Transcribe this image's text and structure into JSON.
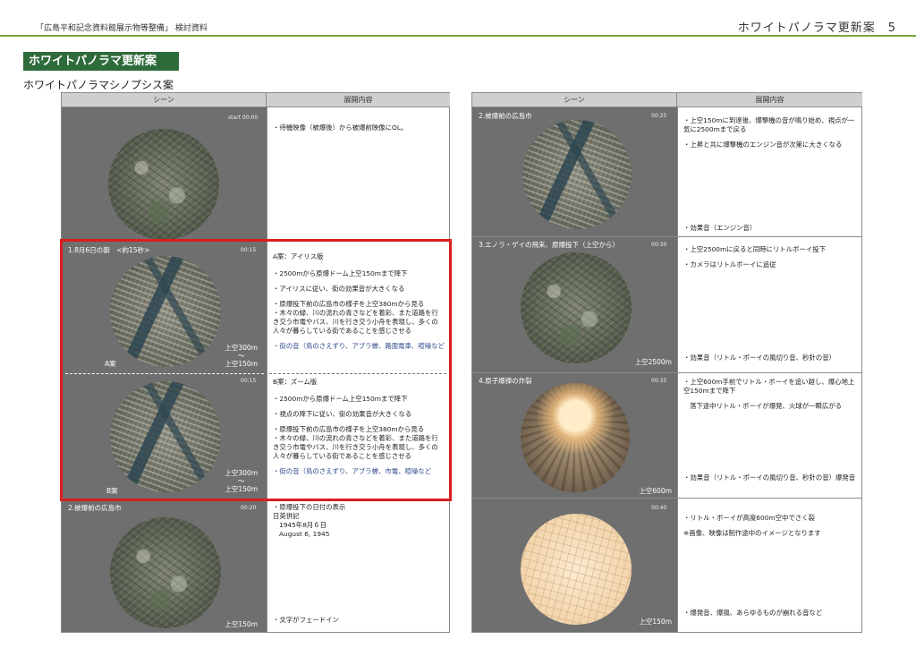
{
  "header": {
    "left": "「広島平和記念資料館展示物等整備」 検討資料",
    "right": "ホワイトパノラマ更新案　5"
  },
  "title": "ホワイトパノラマ更新案",
  "subtitle": "ホワイトパノラマシノプシス案",
  "columns": {
    "scene": "シーン",
    "content": "展開内容"
  },
  "left": {
    "row1": {
      "time": "start 00:00",
      "items": [
        "・待機映像（被爆後）から被爆前映像にOL。"
      ]
    },
    "row2": {
      "title": "1.8月6日の朝　<約15秒>",
      "a": {
        "time": "00:15",
        "label": "A案",
        "alt1": "上空300m",
        "tilde": "〜",
        "alt2": "上空150m",
        "heading": "A案：アイリス版",
        "items": [
          "・2500mから原爆ドーム上空150mまで降下",
          "・アイリスに従い、街の効果音が大きくなる",
          "・原爆投下前の広島市の様子を上空380mから見る",
          "・木々の緑、川の流れの青さなどを着彩、また道路を行き交う市電やバス、川を行き交う小舟を表現し、多くの人々が暮らしている街であることを感じさせる"
        ],
        "sound": "・街の音（鳥のさえずり、アブラ蝉、路面電車、喧噪など"
      },
      "b": {
        "time": "00:15",
        "label": "B案",
        "alt1": "上空300m",
        "tilde": "〜",
        "alt2": "上空150m",
        "heading": "B案：ズーム版",
        "items": [
          "・2500mから原爆ドーム上空150mまで降下",
          "・視点の降下に従い、街の効果音が大きくなる",
          "・原爆投下前の広島市の様子を上空380mから見る",
          "・木々の緑、川の流れの青さなどを着彩、また道路を行き交う市電やバス、川を行き交う小舟を表現し、多くの人々が暮らしている街であることを感じさせる"
        ],
        "sound": "・街の音（鳥のさえずり、アブラ蝉、市電、喧噪など"
      }
    },
    "row3": {
      "title": "2.被爆前の広島市",
      "time": "00:20",
      "alt": "上空150m",
      "lines": [
        "・原爆投下の日付の表示",
        "日英併記",
        "1945年8月６日",
        "August 6, 1945"
      ],
      "bottom": "・文字がフェードイン"
    }
  },
  "right": {
    "row1": {
      "title": "2.被爆前の広島市",
      "time": "00:25",
      "items": [
        "・上空150mに到達後、爆撃機の音が鳴り始め、視点が一気に2500mまで戻る",
        "・上昇と共に爆撃機のエンジン音が次第に大きくなる"
      ],
      "sound": "・効果音（エンジン音）"
    },
    "row2": {
      "title": "3.エノラ・ゲイの飛来、原爆投下（上空から）",
      "time": "00:30",
      "alt": "上空2500m",
      "items": [
        "・上空2500mに戻ると同時にリトルボーイ投下",
        "・カメラはリトルボーイに追従"
      ],
      "sound": "・効果音（リトル・ボーイの風切り音、秒針の音）"
    },
    "row3": {
      "title": "4.原子爆弾の炸裂",
      "time": "00:35",
      "alt": "上空600m",
      "items": [
        "・上空600m手前でリトル・ボーイを追い越し、爆心地上空150mまで降下",
        "落下途中リトル・ボーイが爆発、火球が一瞬広がる"
      ],
      "sound": "・効果音（リトル・ボーイの風切り音、秒針の音）爆発音"
    },
    "row4": {
      "time": "00:40",
      "alt": "上空150m",
      "items": [
        "・リトル・ボーイが高度600m空中でさく裂",
        "※画像、映像は制作途中のイメージとなります"
      ],
      "sound": "・爆発音、爆風、あらゆるものが崩れる音など"
    }
  }
}
